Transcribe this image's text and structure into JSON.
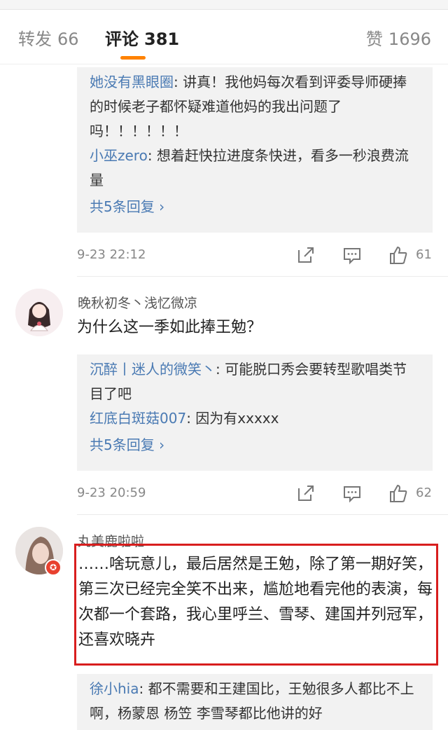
{
  "tabs": {
    "repost_label": "转发",
    "repost_count": "66",
    "comments_label": "评论",
    "comments_count": "381",
    "likes_label": "赞",
    "likes_count": "1696",
    "active_color": "#ff8200"
  },
  "comments": [
    {
      "replies": [
        {
          "name": "她没有黑眼圈",
          "text": ": 讲真！我他妈每次看到评委导师硬捧的时候老子都怀疑难道他妈的我出问题了吗！！！！！！"
        },
        {
          "name": "小巫zero",
          "text": ": 想着赶快拉进度条快进，看多一秒浪费流量"
        }
      ],
      "more": "共5条回复",
      "time": "9-23 22:12",
      "likes": "61"
    },
    {
      "username": "晚秋初冬丶浅忆微凉",
      "text": "为什么这一季如此捧王勉？",
      "replies": [
        {
          "name": "沉醉丨迷人的微笑丶",
          "text": ": 可能脱口秀会要转型歌唱类节目了吧"
        },
        {
          "name": "红底白斑菇007",
          "text": ": 因为有xxxxx"
        }
      ],
      "more": "共5条回复",
      "time": "9-23 20:59",
      "likes": "62"
    },
    {
      "username": "丸美鹿啦啦",
      "badge_icon": "vip-badge-icon",
      "text": "……啥玩意儿，最后居然是王勉，除了第一期好笑，第三次已经完全笑不出来，尴尬地看完他的表演，每次都一个套路，我心里呼兰、雪琴、建国并列冠军，还喜欢晓卉",
      "replies": [
        {
          "name": "徐小hia",
          "text": ": 都不需要和王建国比，王勉很多人都比不上啊，杨蒙恩 杨笠 李雪琴都比他讲的好"
        }
      ]
    }
  ],
  "icons": {
    "share": "share-icon",
    "comment": "comment-icon",
    "like": "thumbs-up-icon"
  }
}
